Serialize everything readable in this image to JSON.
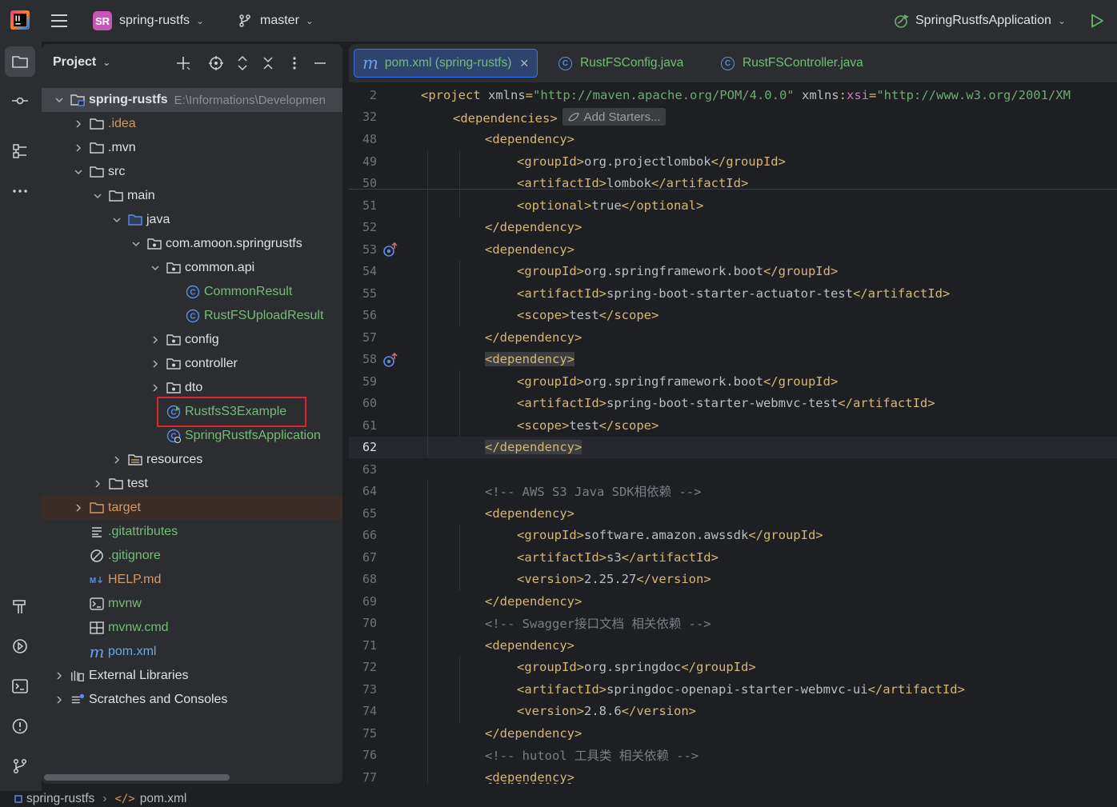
{
  "titlebar": {
    "project_badge": "SR",
    "project_name": "spring-rustfs",
    "branch": "master",
    "run_config": "SpringRustfsApplication"
  },
  "project_panel": {
    "title": "Project",
    "tree": [
      {
        "label": "spring-rustfs",
        "path": "E:\\Informations\\Developmen",
        "depth": 0,
        "arrow": "down",
        "icon": "folder-module-icon",
        "style": "bold",
        "selected": true
      },
      {
        "label": ".idea",
        "depth": 1,
        "arrow": "right",
        "icon": "folder-icon",
        "style": "orange"
      },
      {
        "label": ".mvn",
        "depth": 1,
        "arrow": "right",
        "icon": "folder-icon",
        "style": ""
      },
      {
        "label": "src",
        "depth": 1,
        "arrow": "down",
        "icon": "folder-icon",
        "style": ""
      },
      {
        "label": "main",
        "depth": 2,
        "arrow": "down",
        "icon": "folder-icon",
        "style": ""
      },
      {
        "label": "java",
        "depth": 3,
        "arrow": "down",
        "icon": "source-folder-icon",
        "style": ""
      },
      {
        "label": "com.amoon.springrustfs",
        "depth": 4,
        "arrow": "down",
        "icon": "package-icon",
        "style": ""
      },
      {
        "label": "common.api",
        "depth": 5,
        "arrow": "down",
        "icon": "package-icon",
        "style": ""
      },
      {
        "label": "CommonResult",
        "depth": 6,
        "arrow": "",
        "icon": "class-icon",
        "style": "green"
      },
      {
        "label": "RustFSUploadResult",
        "depth": 6,
        "arrow": "",
        "icon": "class-icon",
        "style": "green"
      },
      {
        "label": "config",
        "depth": 5,
        "arrow": "right",
        "icon": "package-icon",
        "style": ""
      },
      {
        "label": "controller",
        "depth": 5,
        "arrow": "right",
        "icon": "package-icon",
        "style": ""
      },
      {
        "label": "dto",
        "depth": 5,
        "arrow": "right",
        "icon": "package-icon",
        "style": ""
      },
      {
        "label": "RustfsS3Example",
        "depth": 5,
        "arrow": "",
        "icon": "runnable-class-icon",
        "style": "green"
      },
      {
        "label": "SpringRustfsApplication",
        "depth": 5,
        "arrow": "",
        "icon": "spring-boot-class-icon",
        "style": "green"
      },
      {
        "label": "resources",
        "depth": 3,
        "arrow": "right",
        "icon": "resources-folder-icon",
        "style": ""
      },
      {
        "label": "test",
        "depth": 2,
        "arrow": "right",
        "icon": "folder-icon",
        "style": ""
      },
      {
        "label": "target",
        "depth": 1,
        "arrow": "right",
        "icon": "excluded-folder-icon",
        "style": "orange",
        "target": true
      },
      {
        "label": ".gitattributes",
        "depth": 1,
        "arrow": "",
        "icon": "text-file-icon",
        "style": "green"
      },
      {
        "label": ".gitignore",
        "depth": 1,
        "arrow": "",
        "icon": "ignore-file-icon",
        "style": "green"
      },
      {
        "label": "HELP.md",
        "depth": 1,
        "arrow": "",
        "icon": "markdown-icon",
        "style": "orange"
      },
      {
        "label": "mvnw",
        "depth": 1,
        "arrow": "",
        "icon": "shell-script-icon",
        "style": "green"
      },
      {
        "label": "mvnw.cmd",
        "depth": 1,
        "arrow": "",
        "icon": "windows-script-icon",
        "style": "green"
      },
      {
        "label": "pom.xml",
        "depth": 1,
        "arrow": "",
        "icon": "maven-icon",
        "style": "blue"
      },
      {
        "label": "External Libraries",
        "depth": 0,
        "arrow": "right",
        "icon": "libraries-icon",
        "style": ""
      },
      {
        "label": "Scratches and Consoles",
        "depth": 0,
        "arrow": "right",
        "icon": "scratches-icon",
        "style": ""
      }
    ]
  },
  "editor": {
    "tabs": [
      {
        "label": "pom.xml (spring-rustfs)",
        "icon": "maven-icon",
        "active": true
      },
      {
        "label": "RustFSConfig.java",
        "icon": "class-icon",
        "active": false
      },
      {
        "label": "RustFSController.java",
        "icon": "class-icon",
        "active": false
      }
    ],
    "hint_add_starters": "Add Starters...",
    "sticky_lines": [
      {
        "num": "2",
        "indent": 0,
        "html": "project"
      },
      {
        "num": "32",
        "indent": 1,
        "html": "dependencies"
      },
      {
        "num": "48",
        "indent": 2,
        "html": "dependency"
      }
    ],
    "lines": [
      {
        "num": "49",
        "indent": 3,
        "kind": "elem",
        "tag": "groupId",
        "value": "org.projectlombok"
      },
      {
        "num": "50",
        "indent": 3,
        "kind": "elem",
        "tag": "artifactId",
        "value": "lombok"
      },
      {
        "num": "51",
        "indent": 3,
        "kind": "elem",
        "tag": "optional",
        "value": "true"
      },
      {
        "num": "52",
        "indent": 2,
        "kind": "close",
        "tag": "dependency"
      },
      {
        "num": "53",
        "indent": 2,
        "kind": "open",
        "tag": "dependency",
        "gutter": "implemented-icon"
      },
      {
        "num": "54",
        "indent": 3,
        "kind": "elem",
        "tag": "groupId",
        "value": "org.springframework.boot"
      },
      {
        "num": "55",
        "indent": 3,
        "kind": "elem",
        "tag": "artifactId",
        "value": "spring-boot-starter-actuator-test"
      },
      {
        "num": "56",
        "indent": 3,
        "kind": "elem",
        "tag": "scope",
        "value": "test"
      },
      {
        "num": "57",
        "indent": 2,
        "kind": "close",
        "tag": "dependency"
      },
      {
        "num": "58",
        "indent": 2,
        "kind": "open",
        "tag": "dependency",
        "gutter": "implemented-icon",
        "boxed": true
      },
      {
        "num": "59",
        "indent": 3,
        "kind": "elem",
        "tag": "groupId",
        "value": "org.springframework.boot"
      },
      {
        "num": "60",
        "indent": 3,
        "kind": "elem",
        "tag": "artifactId",
        "value": "spring-boot-starter-webmvc-test"
      },
      {
        "num": "61",
        "indent": 3,
        "kind": "elem",
        "tag": "scope",
        "value": "test"
      },
      {
        "num": "62",
        "indent": 2,
        "kind": "close",
        "tag": "dependency",
        "boxed": true,
        "current": true
      },
      {
        "num": "63",
        "indent": 0,
        "kind": "blank"
      },
      {
        "num": "64",
        "indent": 2,
        "kind": "comment",
        "value": "<!-- AWS S3 Java SDK相依赖 -->"
      },
      {
        "num": "65",
        "indent": 2,
        "kind": "open",
        "tag": "dependency"
      },
      {
        "num": "66",
        "indent": 3,
        "kind": "elem",
        "tag": "groupId",
        "value": "software.amazon.awssdk"
      },
      {
        "num": "67",
        "indent": 3,
        "kind": "elem",
        "tag": "artifactId",
        "value": "s3"
      },
      {
        "num": "68",
        "indent": 3,
        "kind": "elem",
        "tag": "version",
        "value": "2.25.27"
      },
      {
        "num": "69",
        "indent": 2,
        "kind": "close",
        "tag": "dependency"
      },
      {
        "num": "70",
        "indent": 2,
        "kind": "comment",
        "value": "<!-- Swagger接口文档 相关依赖 -->"
      },
      {
        "num": "71",
        "indent": 2,
        "kind": "open",
        "tag": "dependency"
      },
      {
        "num": "72",
        "indent": 3,
        "kind": "elem",
        "tag": "groupId",
        "value": "org.springdoc"
      },
      {
        "num": "73",
        "indent": 3,
        "kind": "elem",
        "tag": "artifactId",
        "value": "springdoc-openapi-starter-webmvc-ui"
      },
      {
        "num": "74",
        "indent": 3,
        "kind": "elem",
        "tag": "version",
        "value": "2.8.6"
      },
      {
        "num": "75",
        "indent": 2,
        "kind": "close",
        "tag": "dependency"
      },
      {
        "num": "76",
        "indent": 2,
        "kind": "comment",
        "value": "<!-- hutool 工具类 相关依赖 -->"
      },
      {
        "num": "77",
        "indent": 2,
        "kind": "open",
        "tag": "dependency",
        "squiggly": true
      }
    ],
    "project_line": {
      "xmlns": "http://maven.apache.org/POM/4.0.0",
      "xsi": "http://www.w3.org/2001/XM"
    }
  },
  "statusbar": {
    "project": "spring-rustfs",
    "file": "pom.xml"
  },
  "colors": {
    "accent": "#3574f0",
    "highlight_box": "#e0262c",
    "class_name_green": "#73bd79",
    "xml_tag": "#d5b778",
    "xml_string": "#6aab73",
    "comment": "#7a7e85"
  }
}
